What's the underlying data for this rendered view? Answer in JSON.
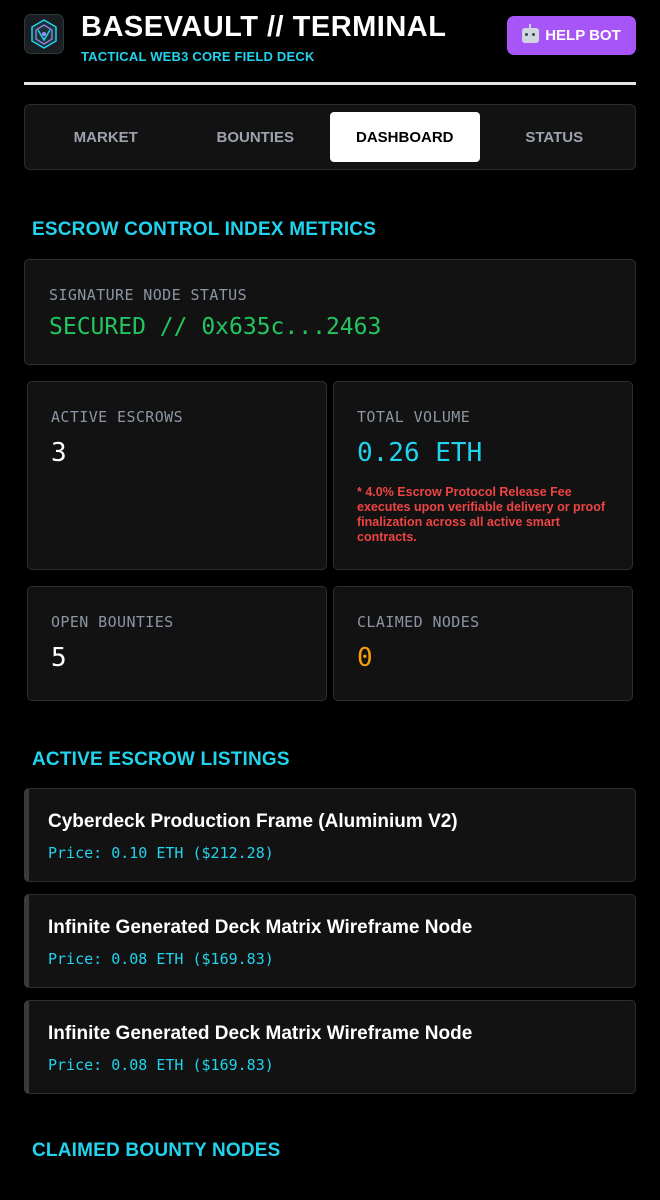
{
  "header": {
    "title": "BASEVAULT // TERMINAL",
    "subtitle": "TACTICAL WEB3 CORE FIELD DECK",
    "logo_icon": "vault-logo-icon",
    "help_button": {
      "icon": "robot-icon",
      "label": "HELP BOT"
    }
  },
  "tabs": [
    {
      "label": "MARKET",
      "active": false
    },
    {
      "label": "BOUNTIES",
      "active": false
    },
    {
      "label": "DASHBOARD",
      "active": true
    },
    {
      "label": "STATUS",
      "active": false
    }
  ],
  "metrics_section": {
    "title": "ESCROW CONTROL INDEX METRICS",
    "signature": {
      "label": "SIGNATURE NODE STATUS",
      "value": "SECURED // 0x635c...2463"
    },
    "active_escrows": {
      "label": "ACTIVE ESCROWS",
      "value": "3"
    },
    "total_volume": {
      "label": "TOTAL VOLUME",
      "value": "0.26 ETH",
      "note": "* 4.0% Escrow Protocol Release Fee executes upon verifiable delivery or proof finalization across all active smart contracts."
    },
    "open_bounties": {
      "label": "OPEN BOUNTIES",
      "value": "5"
    },
    "claimed_nodes": {
      "label": "CLAIMED NODES",
      "value": "0"
    }
  },
  "listings_section": {
    "title": "ACTIVE ESCROW LISTINGS",
    "items": [
      {
        "name": "Cyberdeck Production Frame (Aluminium V2)",
        "price": "Price: 0.10 ETH ($212.28)"
      },
      {
        "name": "Infinite Generated Deck Matrix Wireframe Node",
        "price": "Price: 0.08 ETH ($169.83)"
      },
      {
        "name": "Infinite Generated Deck Matrix Wireframe Node",
        "price": "Price: 0.08 ETH ($169.83)"
      }
    ]
  },
  "claimed_section": {
    "title": "CLAIMED BOUNTY NODES"
  },
  "colors": {
    "accent_cyan": "#22d3ee",
    "help_purple": "#a855f7",
    "secured_green": "#22c55e",
    "warning_red": "#ef4444",
    "claimed_orange": "#f59e0b"
  }
}
